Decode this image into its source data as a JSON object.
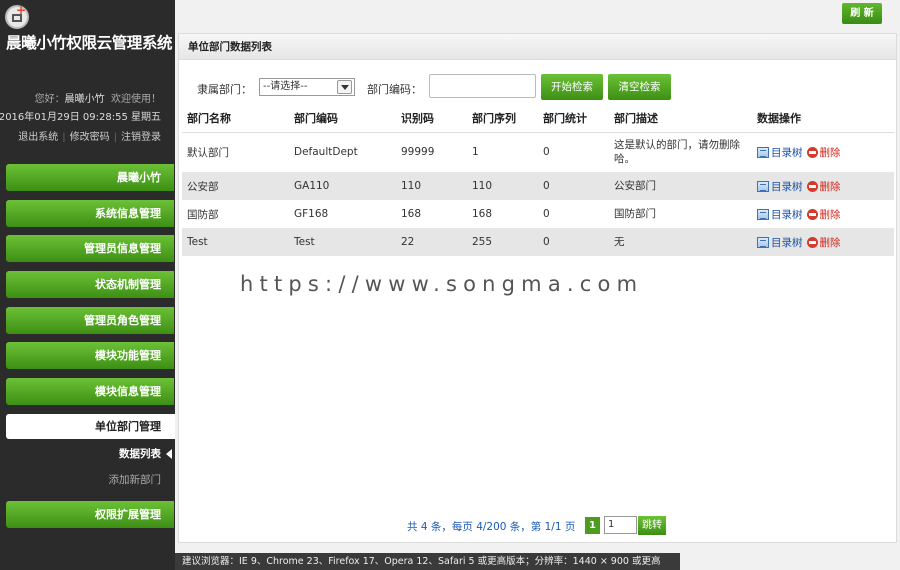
{
  "app": {
    "title": "晨曦小竹权限云管理系统",
    "greeting_prefix": "您好：",
    "user_name": "晨曦小竹",
    "greeting_suffix": "欢迎使用！",
    "datetime": "2016年01月29日 09:28:55 星期五",
    "links": [
      "退出系统",
      "修改密码",
      "注销登录"
    ]
  },
  "sidebar": {
    "items": [
      {
        "label": "晨曦小竹"
      },
      {
        "label": "系统信息管理"
      },
      {
        "label": "管理员信息管理"
      },
      {
        "label": "状态机制管理"
      },
      {
        "label": "管理员角色管理"
      },
      {
        "label": "模块功能管理"
      },
      {
        "label": "模块信息管理"
      },
      {
        "label": "单位部门管理"
      },
      {
        "label": "权限扩展管理"
      }
    ],
    "sub_items": [
      {
        "label": "数据列表"
      },
      {
        "label": "添加新部门"
      }
    ]
  },
  "toolbar": {
    "refresh_label": "刷 新"
  },
  "panel": {
    "title": "单位部门数据列表"
  },
  "filter": {
    "parent_label": "隶属部门：",
    "parent_value": "--请选择--",
    "code_label": "部门编码：",
    "code_value": "",
    "search_label": "开始检索",
    "clear_label": "清空检索"
  },
  "table": {
    "headers": [
      "部门名称",
      "部门编码",
      "识别码",
      "部门序列",
      "部门统计",
      "部门描述",
      "数据操作"
    ],
    "rows": [
      {
        "name": "默认部门",
        "code": "DefaultDept",
        "id": "99999",
        "seq": "1",
        "count": "0",
        "desc": "这是默认的部门，请勿删除哈。"
      },
      {
        "name": "公安部",
        "code": "GA110",
        "id": "110",
        "seq": "110",
        "count": "0",
        "desc": "公安部门"
      },
      {
        "name": "国防部",
        "code": "GF168",
        "id": "168",
        "seq": "168",
        "count": "0",
        "desc": "国防部门"
      },
      {
        "name": "Test",
        "code": "Test",
        "id": "22",
        "seq": "255",
        "count": "0",
        "desc": "无"
      }
    ],
    "op_tree_label": "目录树",
    "op_delete_label": "删除"
  },
  "watermark": "https://www.songma.com",
  "pager": {
    "summary": "共 4 条，每页 4/200 条，第 1/1 页",
    "current_page": "1",
    "input_value": "1",
    "go_label": "跳转"
  },
  "statusbar": {
    "text": "建议浏览器：IE 9、Chrome 23、Firefox 17、Opera 12、Safari 5 或更高版本；分辨率：1440 × 900 或更高"
  },
  "colors": {
    "accent_green": "#4d9b1f",
    "sidebar_bg": "#2b2b2b",
    "link_blue": "#1a5bb3",
    "delete_red": "#d0261b"
  }
}
